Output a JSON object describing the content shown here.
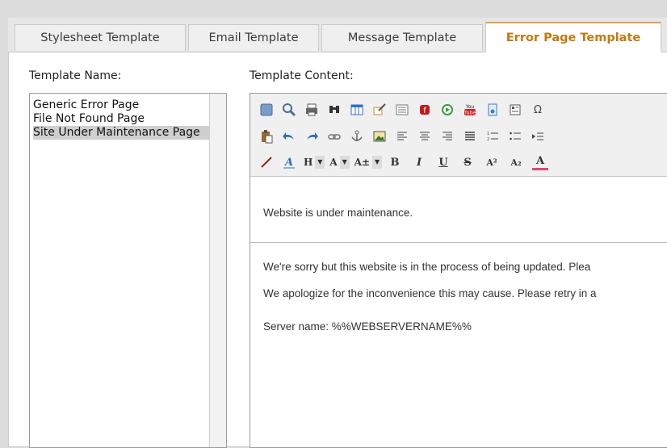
{
  "tabs": [
    {
      "label": "Stylesheet Template"
    },
    {
      "label": "Email Template"
    },
    {
      "label": "Message Template"
    },
    {
      "label": "Error Page Template"
    }
  ],
  "labels": {
    "template_name": "Template Name:",
    "template_content": "Template Content:"
  },
  "templates": [
    {
      "label": "Generic Error Page"
    },
    {
      "label": "File Not Found Page"
    },
    {
      "label": "Site Under Maintenance Page",
      "selected": true
    }
  ],
  "toolbar": {
    "heading_dropdown": "H",
    "font_dropdown": "A",
    "size_dropdown": "A±",
    "bold": "B",
    "italic": "I",
    "underline": "U",
    "strike": "S",
    "superscript": "A²",
    "subscript": "A₂",
    "font_color": "A",
    "special_char": "Ω"
  },
  "content": {
    "heading": "Website is under maintenance.",
    "line1": "We're sorry but this website is in the process of being updated. Plea",
    "line2": "We apologize for the inconvenience this may cause. Please retry in a",
    "line3": "Server name: %%WEBSERVERNAME%%"
  },
  "colors": {
    "active_tab_text": "#c07a10",
    "font_color_underline": "#e0457b"
  }
}
